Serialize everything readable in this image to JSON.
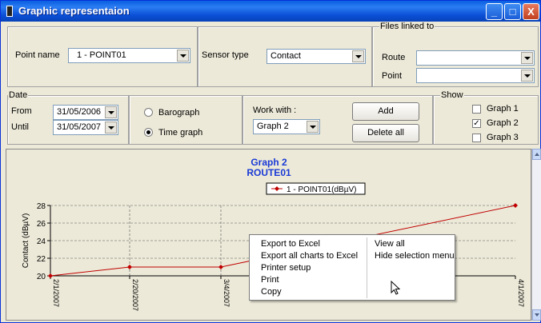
{
  "window": {
    "title": "Graphic representaion",
    "min": "_",
    "max": "□",
    "close": "X"
  },
  "top": {
    "point_name_label": "Point name",
    "point_name_value": "1 - POINT01",
    "sensor_type_label": "Sensor type",
    "sensor_type_value": "Contact",
    "files_group": "Files linked to",
    "route_label": "Route",
    "route_value": "",
    "point_label": "Point",
    "point_value": ""
  },
  "date": {
    "group": "Date",
    "from_label": "From",
    "from_value": "31/05/2006",
    "until_label": "Until",
    "until_value": "31/05/2007"
  },
  "mode": {
    "barograph": "Barograph",
    "time_graph": "Time graph",
    "selected": "time_graph"
  },
  "work": {
    "label": "Work with :",
    "value": "Graph 2",
    "add": "Add",
    "delete_all": "Delete all"
  },
  "show": {
    "group": "Show",
    "items": [
      {
        "label": "Graph 1",
        "checked": false
      },
      {
        "label": "Graph 2",
        "checked": true
      },
      {
        "label": "Graph 3",
        "checked": false
      }
    ]
  },
  "chart_data": {
    "type": "line",
    "title": "Graph 2",
    "subtitle": "ROUTE01",
    "ylabel": "Contact (dBµV)",
    "xlabel": "",
    "ylim": [
      20,
      28
    ],
    "yticks": [
      "20",
      "22",
      "24",
      "26",
      "28"
    ],
    "x": [
      "2/1/2007",
      "2/20/2007",
      "3/4/2007",
      "4/1/2007"
    ],
    "series": [
      {
        "name": "1 - POINT01(dBµV)",
        "values": [
          20,
          21,
          21,
          28
        ]
      }
    ],
    "grid": true,
    "legend": "top-center",
    "color": "#c00000"
  },
  "context_menu": {
    "left": [
      "Export to Excel",
      "Export all charts to Excel",
      "Printer setup",
      "Print",
      "Copy"
    ],
    "right": [
      "View all",
      "Hide selection menu"
    ]
  }
}
